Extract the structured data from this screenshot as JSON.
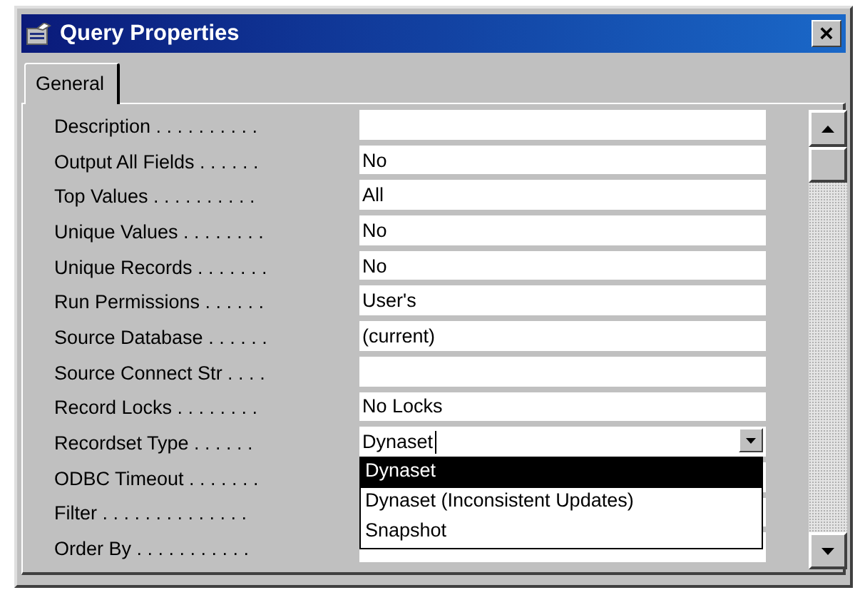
{
  "window": {
    "title": "Query Properties",
    "close_label": "×"
  },
  "tabs": [
    {
      "label": "General",
      "selected": true
    }
  ],
  "properties": [
    {
      "label": "Description . . . . . . . . . .",
      "kind": "text"
    },
    {
      "label": "Output All Fields . . . . . .",
      "kind": "text",
      "value": "No"
    },
    {
      "label": "Top Values . . . . . . . . . .",
      "kind": "text",
      "value": "All"
    },
    {
      "label": "Unique Values . . . . . . . .",
      "kind": "text",
      "value": "No"
    },
    {
      "label": "Unique Records . . . . . . .",
      "kind": "text",
      "value": "No"
    },
    {
      "label": "Run Permissions . . . . . .",
      "kind": "text",
      "value": "User's"
    },
    {
      "label": "Source Database . . . . . .",
      "kind": "text",
      "value": "(current)"
    },
    {
      "label": "Source Connect Str . . . .",
      "kind": "text"
    },
    {
      "label": "Record Locks . . . . . . . .",
      "kind": "text",
      "value": "No Locks"
    },
    {
      "label": "Recordset Type . . . . . .",
      "kind": "combo",
      "value": "Dynaset",
      "expanded": true,
      "options": [
        {
          "label": "Dynaset",
          "selected": true
        },
        {
          "label": "Dynaset (Inconsistent Updates)",
          "selected": false
        },
        {
          "label": "Snapshot",
          "selected": false
        }
      ]
    },
    {
      "label": "ODBC Timeout . . . . . . .",
      "kind": "hidden"
    },
    {
      "label": "Filter . . . . . . . . . . . . . .",
      "kind": "hidden"
    },
    {
      "label": "Order By . . . . . . . . . . .",
      "kind": "hidden"
    }
  ]
}
